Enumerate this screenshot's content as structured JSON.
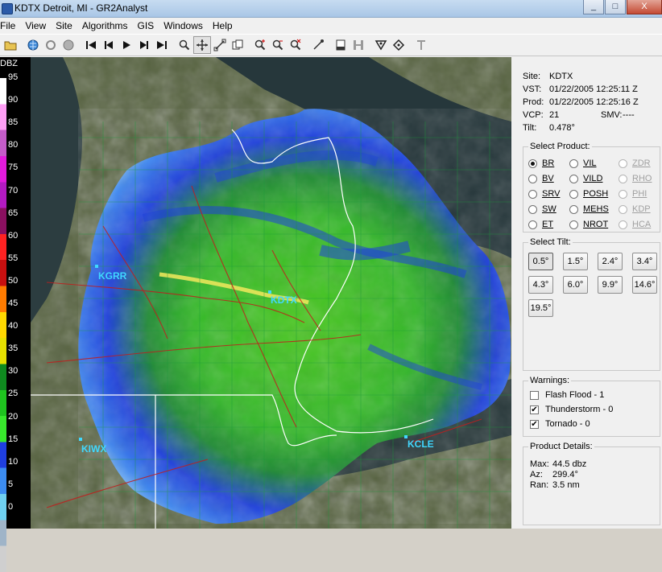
{
  "window": {
    "title": "KDTX Detroit, MI - GR2Analyst",
    "minimize_label": "_",
    "maximize_label": "□",
    "close_label": "X"
  },
  "menu": [
    "File",
    "View",
    "Site",
    "Algorithms",
    "GIS",
    "Windows",
    "Help"
  ],
  "colorbar": {
    "unit": "DBZ",
    "labels": [
      "95",
      "90",
      "85",
      "80",
      "75",
      "70",
      "65",
      "60",
      "55",
      "50",
      "45",
      "40",
      "35",
      "30",
      "25",
      "20",
      "15",
      "10",
      "5",
      "0"
    ]
  },
  "map": {
    "stations": [
      {
        "id": "KGRR"
      },
      {
        "id": "KDTX"
      },
      {
        "id": "KIWX"
      },
      {
        "id": "KCLE"
      }
    ]
  },
  "info": {
    "site_label": "Site:",
    "site": "KDTX",
    "vst_label": "VST:",
    "vst": "01/22/2005  12:25:11 Z",
    "prod_label": "Prod:",
    "prod": "01/22/2005  12:25:16 Z",
    "vcp_label": "VCP:",
    "vcp": "21",
    "smv_label": "SMV:",
    "smv": "----",
    "tilt_label": "Tilt:",
    "tilt": "0.478°"
  },
  "select_product": {
    "legend": "Select Product:",
    "col1": [
      "BR",
      "BV",
      "SRV",
      "SW",
      "ET"
    ],
    "col2": [
      "VIL",
      "VILD",
      "POSH",
      "MEHS",
      "NROT"
    ],
    "col3": [
      "ZDR",
      "RHO",
      "PHI",
      "KDP",
      "HCA"
    ],
    "selected": "BR"
  },
  "select_tilt": {
    "legend": "Select Tilt:",
    "tilts": [
      "0.5°",
      "1.5°",
      "2.4°",
      "3.4°",
      "4.3°",
      "6.0°",
      "9.9°",
      "14.6°",
      "19.5°"
    ],
    "selected": "0.5°"
  },
  "warnings": {
    "legend": "Warnings:",
    "items": [
      {
        "label": "Flash Flood - 1",
        "checked": false
      },
      {
        "label": "Thunderstorm - 0",
        "checked": true
      },
      {
        "label": "Tornado - 0",
        "checked": true
      }
    ]
  },
  "product_details": {
    "legend": "Product Details:",
    "max_label": "Max:",
    "max": "44.5 dbz",
    "az_label": "Az:",
    "az": "299.4°",
    "ran_label": "Ran:",
    "ran": "3.5 nm"
  }
}
